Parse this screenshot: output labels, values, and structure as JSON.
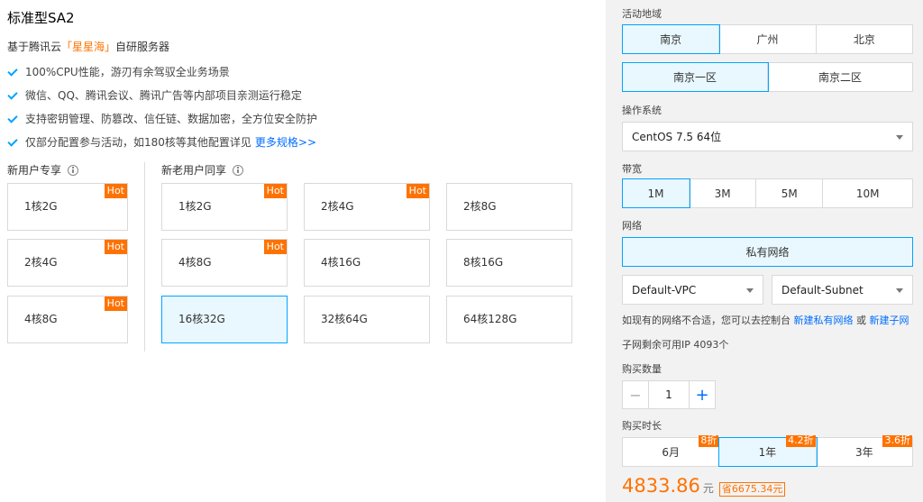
{
  "product": {
    "title": "标准型SA2",
    "subtitle_pre": "基于腾讯云",
    "subtitle_brand": "「星星海」",
    "subtitle_post": "自研服务器",
    "features": [
      "100%CPU性能，游刃有余驾驭全业务场景",
      "微信、QQ、腾讯会议、腾讯广告等内部项目亲测运行稳定",
      "支持密钥管理、防篡改、信任链、数据加密，全方位安全防护",
      "仅部分配置参与活动，如180核等其他配置详见"
    ],
    "more_link": "更多规格>>"
  },
  "new_user": {
    "label": "新用户专享",
    "cards": [
      {
        "label": "1核2G",
        "hot": "Hot"
      },
      {
        "label": "2核4G",
        "hot": "Hot"
      },
      {
        "label": "4核8G",
        "hot": "Hot"
      }
    ]
  },
  "all_user": {
    "label": "新老用户同享",
    "cards": [
      {
        "label": "1核2G",
        "hot": "Hot"
      },
      {
        "label": "2核4G",
        "hot": "Hot"
      },
      {
        "label": "2核8G",
        "hot": ""
      },
      {
        "label": "4核8G",
        "hot": "Hot"
      },
      {
        "label": "4核16G",
        "hot": ""
      },
      {
        "label": "8核16G",
        "hot": ""
      },
      {
        "label": "16核32G",
        "hot": "",
        "selected": true
      },
      {
        "label": "32核64G",
        "hot": ""
      },
      {
        "label": "64核128G",
        "hot": ""
      }
    ]
  },
  "panel": {
    "region_label": "活动地域",
    "regions": [
      "南京",
      "广州",
      "北京"
    ],
    "zones": [
      "南京一区",
      "南京二区"
    ],
    "os_label": "操作系统",
    "os_value": "CentOS 7.5 64位",
    "bandwidth_label": "带宽",
    "bandwidths": [
      "1M",
      "3M",
      "5M",
      "10M"
    ],
    "network_label": "网络",
    "network_value": "私有网络",
    "vpc_value": "Default-VPC",
    "subnet_value": "Default-Subnet",
    "network_note_pre": "如现有的网络不合适，您可以去控制台",
    "network_note_link1": "新建私有网络",
    "network_note_mid": "或",
    "network_note_link2": "新建子网",
    "subnet_ip_note": "子网剩余可用IP 4093个",
    "qty_label": "购买数量",
    "qty_minus": "−",
    "qty_value": "1",
    "qty_plus": "+",
    "duration_label": "购买时长",
    "durations": [
      {
        "label": "6月",
        "discount": "8折"
      },
      {
        "label": "1年",
        "discount": "4.2折"
      },
      {
        "label": "3年",
        "discount": "3.6折"
      }
    ],
    "price": "4833.86",
    "price_unit": "元",
    "save_text": "省6675.34元"
  },
  "colors": {
    "accent": "#00a4ff",
    "link": "#006eff",
    "orange": "#ff7200"
  }
}
